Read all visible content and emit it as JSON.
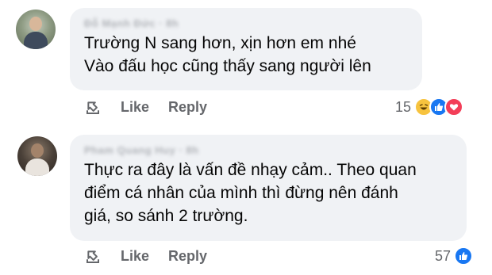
{
  "comments": [
    {
      "author": "Đỗ Mạnh Đức · 8h",
      "text": "Trường N sang hơn, xịn hơn em nhé\nVào đấu học cũng thấy sang người lên",
      "actions": {
        "like_label": "Like",
        "reply_label": "Reply"
      },
      "reaction_count": "15",
      "reactions": [
        "haha-icon",
        "like-icon",
        "love-icon"
      ]
    },
    {
      "author": "Pham Quang Huy · 8h",
      "text": "Thực ra đây là vấn đề nhạy cảm.. Theo quan\nđiểm cá nhân của mình thì đừng nên đánh\ngiá, so sánh 2 trường.",
      "actions": {
        "like_label": "Like",
        "reply_label": "Reply"
      },
      "reaction_count": "57",
      "reactions": [
        "like-icon"
      ]
    }
  ],
  "colors": {
    "bubble": "#f0f2f5",
    "action_text": "#65676b",
    "like_blue": "#1877f2",
    "love_red": "#f33e58",
    "haha_yellow": "#f7c33e"
  }
}
